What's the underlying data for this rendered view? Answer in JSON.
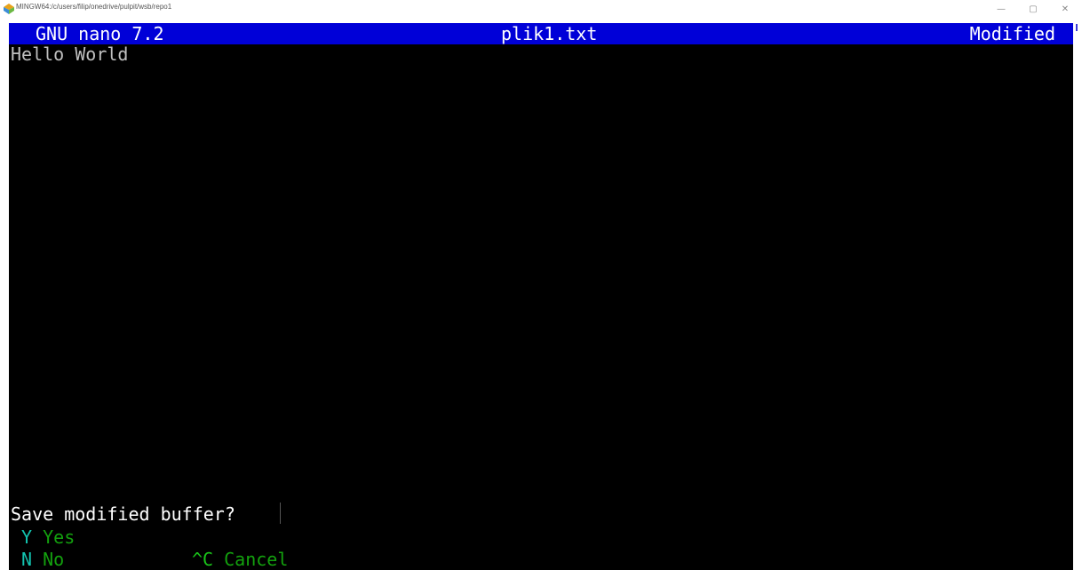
{
  "window": {
    "title": "MINGW64:/c/users/filip/onedrive/pulpit/wsb/repo1",
    "controls": {
      "minimize": "—",
      "maximize": "▢",
      "close": "✕"
    }
  },
  "nano": {
    "header": {
      "version": "GNU nano 7.2",
      "filename": "plik1.txt",
      "status": "Modified"
    },
    "buffer": [
      "Hello World"
    ],
    "prompt": "Save modified buffer?",
    "options": [
      {
        "key": "Y",
        "label": "Yes"
      },
      {
        "key": "N",
        "label": "No"
      },
      {
        "key": "^C",
        "label": "Cancel"
      }
    ]
  },
  "colors": {
    "header_bg": "#0000d8",
    "terminal_bg": "#000000",
    "option_text": "#13a10e"
  }
}
